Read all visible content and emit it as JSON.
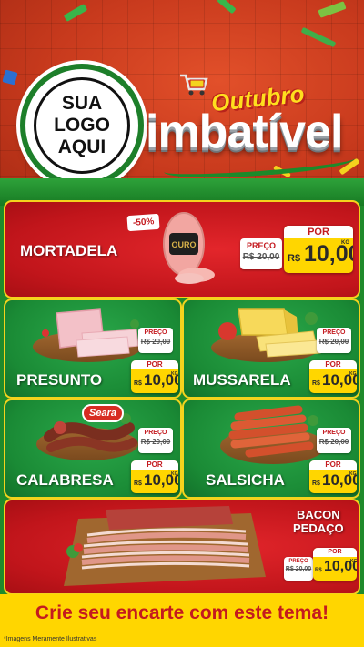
{
  "header": {
    "logo_line1": "SUA",
    "logo_line2": "LOGO",
    "logo_line3": "AQUI",
    "campaign_top": "Outubro",
    "campaign_main": "imbatível"
  },
  "products": [
    {
      "name": "MORTADELA",
      "badge": "-50%",
      "old_label": "PREÇO",
      "old_price": "R$ 20,00",
      "new_label": "POR",
      "currency": "R$",
      "new_price": "10,00",
      "unit": "KG"
    },
    {
      "name": "PRESUNTO",
      "old_label": "PREÇO",
      "old_price": "R$ 20,00",
      "new_label": "POR",
      "currency": "R$",
      "new_price": "10,00",
      "unit": "KG"
    },
    {
      "name": "MUSSARELA",
      "old_label": "PREÇO",
      "old_price": "R$ 20,00",
      "new_label": "POR",
      "currency": "R$",
      "new_price": "10,00",
      "unit": "KG"
    },
    {
      "name": "CALABRESA",
      "brand": "Seara",
      "old_label": "PREÇO",
      "old_price": "R$ 20,00",
      "new_label": "POR",
      "currency": "R$",
      "new_price": "10,00",
      "unit": "KG"
    },
    {
      "name": "SALSICHA",
      "old_label": "PREÇO",
      "old_price": "R$ 20,00",
      "new_label": "POR",
      "currency": "R$",
      "new_price": "10,00",
      "unit": "KG"
    },
    {
      "name_line1": "BACON",
      "name_line2": "PEDAÇO",
      "old_label": "PREÇO",
      "old_price": "R$ 20,00",
      "new_label": "POR",
      "currency": "R$",
      "new_price": "10,00",
      "unit": "KG"
    }
  ],
  "footer": {
    "cta": "Crie seu encarte com este tema!",
    "disclaimer": "*Imagens Meramente Ilustrativas"
  },
  "colors": {
    "red": "#c1151b",
    "green": "#1a8a35",
    "yellow": "#ffd600"
  }
}
